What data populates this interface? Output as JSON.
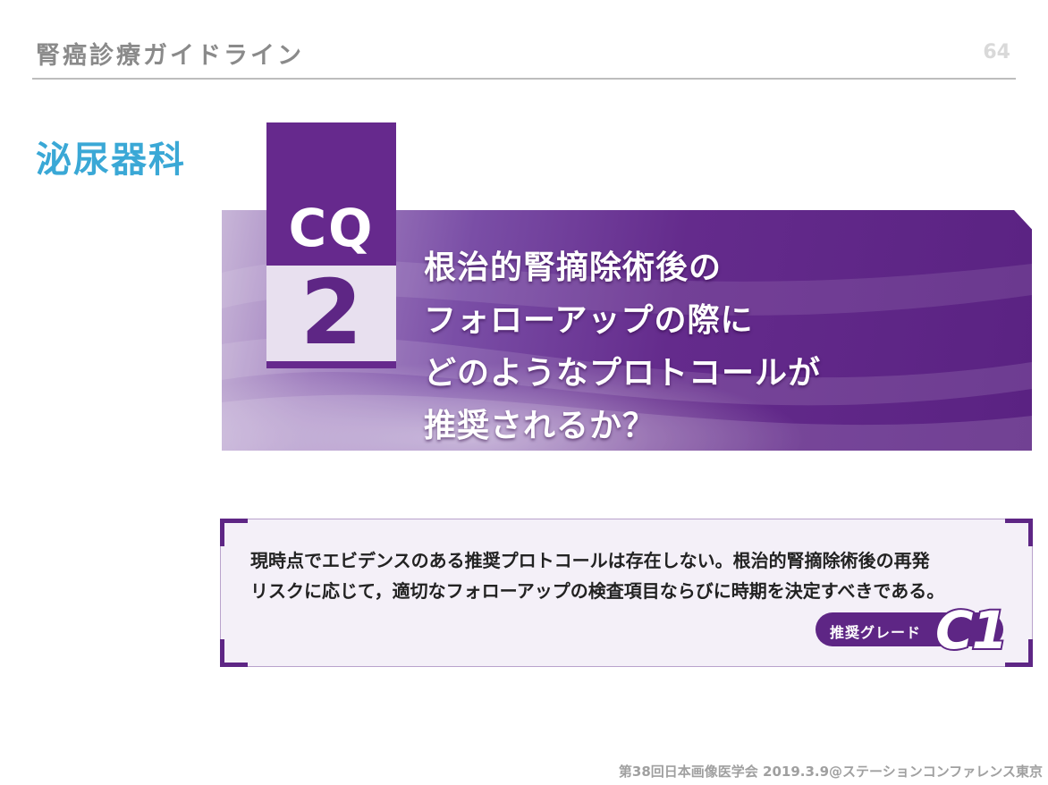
{
  "header": {
    "title": "腎癌診療ガイドライン",
    "page_number": "64"
  },
  "department": "泌尿器科",
  "cq": {
    "label": "CQ",
    "number": "2",
    "question_lines": [
      "根治的腎摘除術後の",
      "フォローアップの際に",
      "どのようなプロトコールが",
      "推奨されるか？"
    ]
  },
  "answer": {
    "lines": [
      "現時点でエビデンスのある推奨プロトコールは存在しない。根治的腎摘除術後の再発",
      "リスクに応じて，適切なフォローアップの検査項目ならびに時期を決定すべきである。"
    ],
    "grade_label": "推奨グレード",
    "grade_value": "C1"
  },
  "footer": "第38回日本画像医学会 2019.3.9@ステーションコンファレンス東京",
  "colors": {
    "purple": "#5e2685",
    "department_blue": "#3aa8d6"
  }
}
